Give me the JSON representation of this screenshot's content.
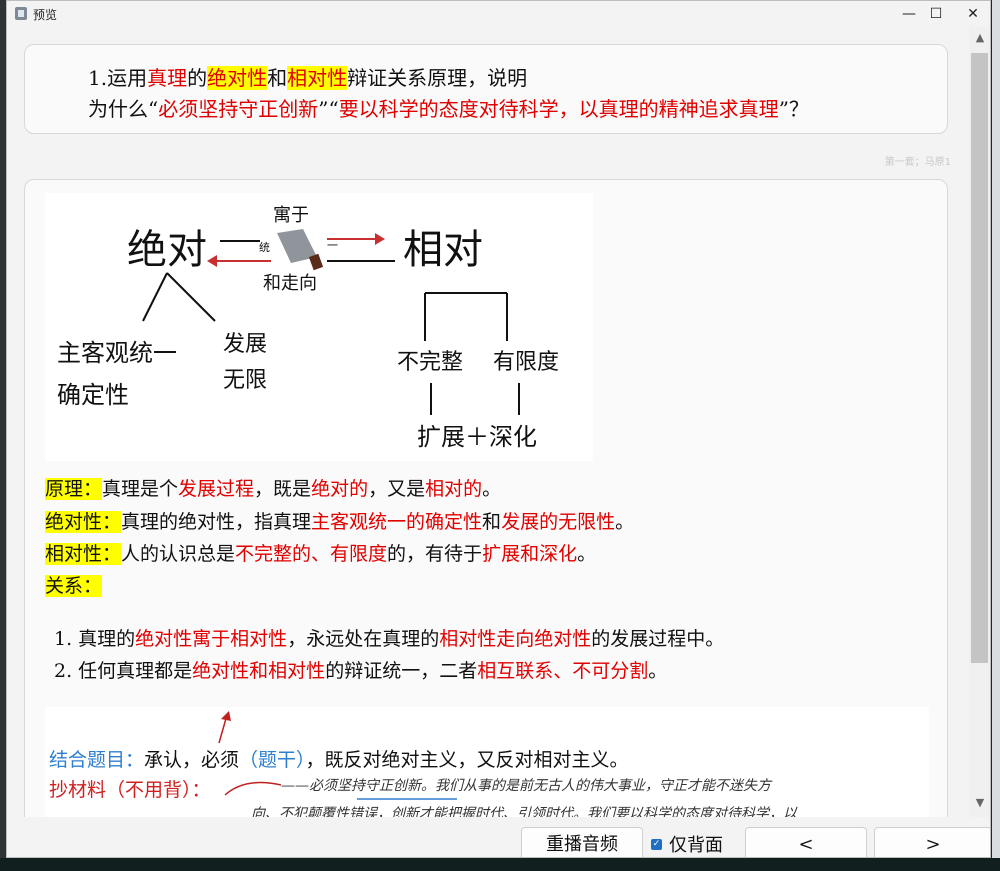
{
  "window": {
    "title": "预览",
    "minimize": "—",
    "maximize": "☐",
    "close": "✕"
  },
  "question": {
    "prefix": "1.运用",
    "t1": "真理",
    "t2": "的",
    "t3": "绝对性",
    "t4": "和",
    "t5": "相对性",
    "t6": "辩证关系原理，说明",
    "l2a": "为什么“",
    "l2b": "必须坚持守正创新",
    "l2c": "”“",
    "l2d": "要以科学的态度对待科学，以真理的精神追求真理",
    "l2e": "”？"
  },
  "meta": "第一套；马原1",
  "note_image": {
    "absolute": "绝对",
    "relative": "相对",
    "contains": "寓于",
    "tong": "统",
    "yi": "一",
    "toward": "和走向",
    "subj_obj": "主客观统一",
    "certainty": "确定性",
    "development": "发展",
    "infinite": "无限",
    "incomplete": "不完整",
    "limited": "有限度",
    "expand": "扩展＋深化"
  },
  "answer": {
    "principle_label": "原理：",
    "p1": "真理是个",
    "p2": "发展过程",
    "p3": "，既是",
    "p4": "绝对的",
    "p5": "，又是",
    "p6": "相对的",
    "p7": "。",
    "abs_label": "绝对性：",
    "a1": "真理的绝对性，指真理",
    "a2": "主客观统一的确定性",
    "a3": "和",
    "a4": "发展的无限性",
    "a5": "。",
    "rel_label": "相对性：",
    "r1": "人的认识总是",
    "r2": "不完整的、有限度",
    "r3": "的，有待于",
    "r4": "扩展和深化",
    "r5": "。",
    "relation_label": "关系："
  },
  "relations": [
    {
      "n": "1. 真理的",
      "b": "绝对性寓于相对性",
      "c": "，永远处在真理的",
      "d": "相对性走向绝对性",
      "e": "的发展过程中。"
    },
    {
      "n": "2. 任何真理都是",
      "b": "绝对性和相对性",
      "c": "的辩证统一，二者",
      "d": "相互联系、不可分割",
      "e": "。"
    }
  ],
  "source_image": {
    "combine_label": "结合题目：",
    "combine_text1": "承认，必须",
    "combine_paren": "（题干）",
    "combine_text2": "，既反对绝对主义，又反对相对主义。",
    "copy_label": "抄材料（不用背）：",
    "quote_line1": "——必须坚持守正创新。我们从事的是前无古人的伟大事业，守正才能不迷失方",
    "quote_line2": "向、不犯颠覆性错误，创新才能把握时代、引领时代。我们要以科学的态度对待科学，以"
  },
  "controls": {
    "replay": "重播音频",
    "back_only": "仅背面",
    "back_only_checked": true,
    "prev": "<",
    "next": ">"
  },
  "colors": {
    "red": "#e00000",
    "highlight": "#ffff00",
    "checkbox": "#1f6fc4",
    "blue_text": "#2f7fd0"
  }
}
